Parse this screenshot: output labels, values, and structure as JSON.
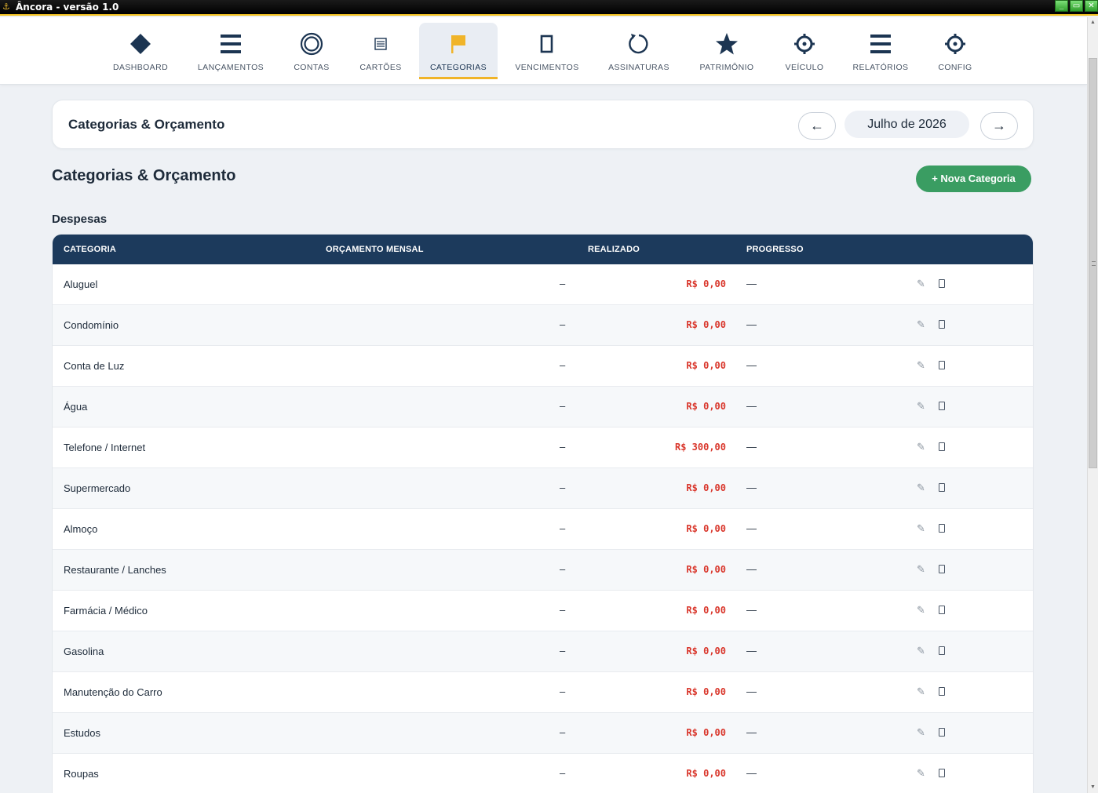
{
  "window": {
    "title": "Âncora - versão 1.0",
    "buttons": [
      "_",
      "▭",
      "✕"
    ]
  },
  "nav": {
    "items": [
      {
        "label": "DASHBOARD",
        "icon": "diamond-icon",
        "active": false
      },
      {
        "label": "LANÇAMENTOS",
        "icon": "list-icon",
        "active": false
      },
      {
        "label": "CONTAS",
        "icon": "circle-icon",
        "active": false
      },
      {
        "label": "CARTÕES",
        "icon": "card-icon",
        "active": false
      },
      {
        "label": "CATEGORIAS",
        "icon": "flag-icon",
        "active": true
      },
      {
        "label": "VENCIMENTOS",
        "icon": "rectangle-icon",
        "active": false
      },
      {
        "label": "ASSINATURAS",
        "icon": "refresh-icon",
        "active": false
      },
      {
        "label": "PATRIMÔNIO",
        "icon": "star-icon",
        "active": false
      },
      {
        "label": "VEÍCULO",
        "icon": "gear-icon",
        "active": false
      },
      {
        "label": "RELATÓRIOS",
        "icon": "list-icon",
        "active": false
      },
      {
        "label": "CONFIG",
        "icon": "gear-icon",
        "active": false
      }
    ]
  },
  "header": {
    "title": "Categorias & Orçamento",
    "prev": "←",
    "month": "Julho de 2026",
    "next": "→"
  },
  "main": {
    "title": "Categorias & Orçamento",
    "new_button": "+ Nova Categoria",
    "section": "Despesas"
  },
  "table": {
    "columns": [
      "CATEGORIA",
      "ORÇAMENTO MENSAL",
      "REALIZADO",
      "PROGRESSO"
    ],
    "rows": [
      {
        "name": "Aluguel",
        "budget": "–",
        "realized": "R$ 0,00",
        "progress": "—"
      },
      {
        "name": "Condomínio",
        "budget": "–",
        "realized": "R$ 0,00",
        "progress": "—"
      },
      {
        "name": "Conta de Luz",
        "budget": "–",
        "realized": "R$ 0,00",
        "progress": "—"
      },
      {
        "name": "Água",
        "budget": "–",
        "realized": "R$ 0,00",
        "progress": "—"
      },
      {
        "name": "Telefone / Internet",
        "budget": "–",
        "realized": "R$ 300,00",
        "progress": "—"
      },
      {
        "name": "Supermercado",
        "budget": "–",
        "realized": "R$ 0,00",
        "progress": "—"
      },
      {
        "name": "Almoço",
        "budget": "–",
        "realized": "R$ 0,00",
        "progress": "—"
      },
      {
        "name": "Restaurante / Lanches",
        "budget": "–",
        "realized": "R$ 0,00",
        "progress": "—"
      },
      {
        "name": "Farmácia / Médico",
        "budget": "–",
        "realized": "R$ 0,00",
        "progress": "—"
      },
      {
        "name": "Gasolina",
        "budget": "–",
        "realized": "R$ 0,00",
        "progress": "—"
      },
      {
        "name": "Manutenção do Carro",
        "budget": "–",
        "realized": "R$ 0,00",
        "progress": "—"
      },
      {
        "name": "Estudos",
        "budget": "–",
        "realized": "R$ 0,00",
        "progress": "—"
      },
      {
        "name": "Roupas",
        "budget": "–",
        "realized": "R$ 0,00",
        "progress": "—"
      }
    ],
    "edit_icon": "✎"
  },
  "colors": {
    "navy": "#1c3a5c",
    "accent": "#f0b429",
    "green": "#3a9d62",
    "red": "#d9362b"
  }
}
